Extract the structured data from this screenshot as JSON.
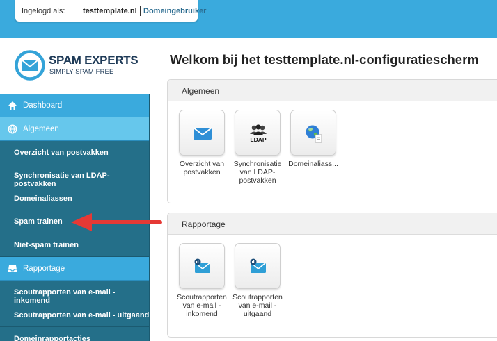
{
  "header": {
    "login_label": "Ingelogd als:",
    "domain": "testtemplate.nl",
    "role": "Domeingebruiker"
  },
  "logo": {
    "brand": "SPAM EXPERTS",
    "tagline": "SIMPLY SPAM FREE"
  },
  "sidebar": {
    "items": [
      {
        "label": "Dashboard",
        "type": "head",
        "icon": "home-icon"
      },
      {
        "label": "Algemeen",
        "type": "head-active",
        "icon": "globe-icon"
      },
      {
        "label": "Overzicht van postvakken",
        "type": "sub"
      },
      {
        "label": "Synchronisatie van LDAP-postvakken",
        "type": "sub"
      },
      {
        "label": "Domeinaliassen",
        "type": "sub"
      },
      {
        "label": "Spam trainen",
        "type": "sub"
      },
      {
        "label": "Niet-spam trainen",
        "type": "sub"
      },
      {
        "label": "Rapportage",
        "type": "head",
        "icon": "inbox-icon"
      },
      {
        "label": "Scoutrapporten van e-mail - inkomend",
        "type": "sub"
      },
      {
        "label": "Scoutrapporten van e-mail - uitgaand",
        "type": "sub"
      },
      {
        "label": "Domeinrapportacties",
        "type": "sub"
      }
    ]
  },
  "main": {
    "title": "Welkom bij het testtemplate.nl-configuratiescherm",
    "panels": [
      {
        "title": "Algemeen",
        "tiles": [
          {
            "label": "Overzicht van postvakken",
            "icon": "envelope-icon"
          },
          {
            "label": "Synchronisatie van LDAP-postvakken",
            "icon": "ldap-users-icon",
            "icon_text": "LDAP"
          },
          {
            "label": "Domeinaliass...",
            "icon": "globe-document-icon"
          }
        ]
      },
      {
        "title": "Rapportage",
        "tiles": [
          {
            "label": "Scoutrapporten van e-mail - inkomend",
            "icon": "mail-report-in-icon"
          },
          {
            "label": "Scoutrapporten van e-mail - uitgaand",
            "icon": "mail-report-out-icon"
          }
        ]
      }
    ]
  },
  "colors": {
    "topbar": "#3aaadd",
    "sidebar_head": "#3aaadd",
    "sidebar_head_active": "#66c7ec",
    "sidebar_sub": "#246f89",
    "arrow": "#e53935"
  }
}
